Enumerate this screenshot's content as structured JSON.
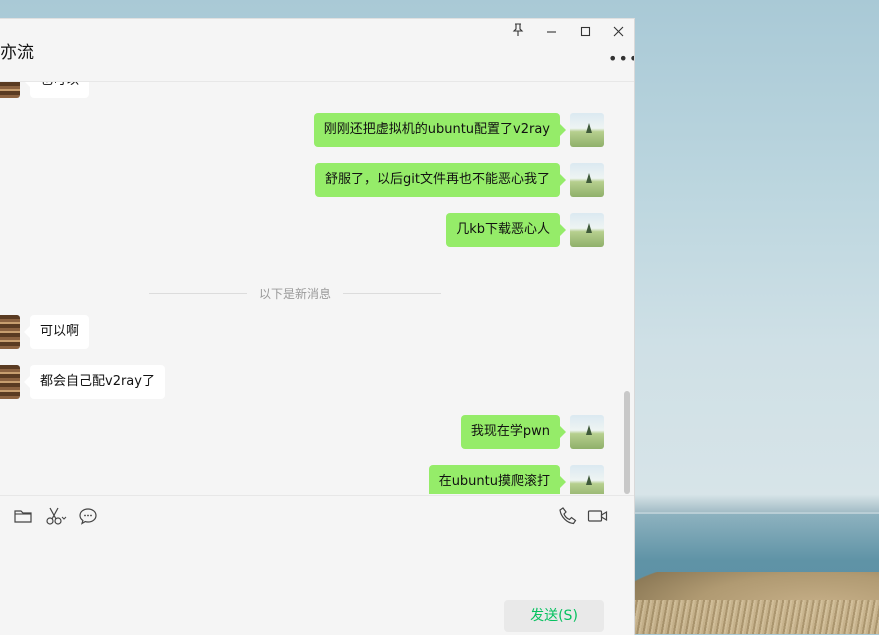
{
  "window": {
    "title": "亦流",
    "controls": {
      "pin": "pin-icon",
      "minimize": "minimize-icon",
      "maximize": "maximize-icon",
      "close": "close-icon"
    },
    "more": "•••"
  },
  "messages": [
    {
      "sender": "other",
      "text": "也可以"
    },
    {
      "sender": "me",
      "text": "刚刚还把虚拟机的ubuntu配置了v2ray"
    },
    {
      "sender": "me",
      "text": "舒服了，以后git文件再也不能恶心我了"
    },
    {
      "sender": "me",
      "text": "几kb下载恶心人"
    },
    {
      "sender": "other",
      "text": "可以啊"
    },
    {
      "sender": "other",
      "text": "都会自己配v2ray了"
    },
    {
      "sender": "me",
      "text": "我现在学pwn"
    },
    {
      "sender": "me",
      "text": "在ubuntu摸爬滚打"
    }
  ],
  "divider_text": "以下是新消息",
  "toolbar": {
    "left_icons": [
      "folder-icon",
      "scissors-icon",
      "chat-bubble-icon"
    ],
    "right_icons": [
      "phone-icon",
      "video-icon"
    ]
  },
  "input": {
    "value": ""
  },
  "send_label": "发送(S)",
  "colors": {
    "my_bubble": "#95ec69",
    "other_bubble": "#ffffff",
    "send_text": "#07c160",
    "chat_bg": "#f5f5f5"
  }
}
